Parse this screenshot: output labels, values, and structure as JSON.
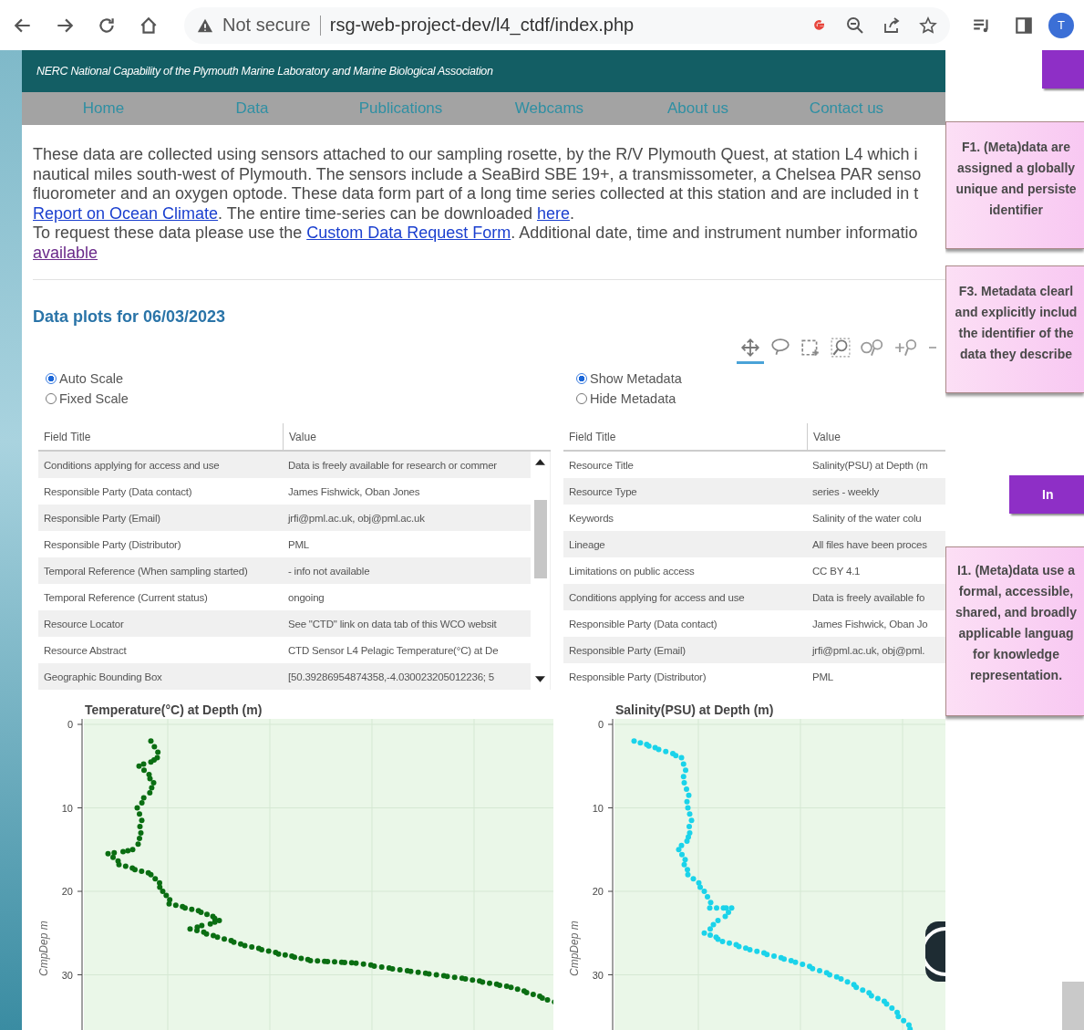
{
  "browser": {
    "security": "Not secure",
    "url": "rsg-web-project-dev/l4_ctdf/index.php",
    "profile_initial": "T"
  },
  "header": {
    "subtitle": "NERC National Capability of the Plymouth Marine Laboratory and Marine Biological Association"
  },
  "nav": [
    "Home",
    "Data",
    "Publications",
    "Webcams",
    "About us",
    "Contact us"
  ],
  "intro": [
    [
      {
        "text": "These data are collected using sensors attached to our sampling rosette, by the R/V Plymouth Quest, at station L4 which i",
        "link": false
      }
    ],
    [
      {
        "text": "nautical miles south-west of Plymouth. The sensors include a SeaBird SBE 19+, a transmissometer, a Chelsea PAR senso",
        "link": false
      }
    ],
    [
      {
        "text": "fluorometer and an oxygen optode. These data form part of a long time series collected at this station and are included in t",
        "link": false
      }
    ],
    [
      {
        "text": "Report on Ocean Climate",
        "link": true
      },
      {
        "text": ". The entire time-series can be downloaded ",
        "link": false
      },
      {
        "text": "here",
        "link": true
      },
      {
        "text": ".",
        "link": false
      }
    ],
    [
      {
        "text": "To request these data please use the ",
        "link": false
      },
      {
        "text": "Custom Data Request Form",
        "link": true
      },
      {
        "text": ". Additional date, time and instrument number informatio",
        "link": false
      }
    ],
    [
      {
        "text": "available",
        "link": true
      }
    ]
  ],
  "section_title": "Data plots for 06/03/2023",
  "plot_tools": [
    {
      "kind": "pan",
      "selected": true
    },
    {
      "kind": "lasso",
      "selected": false
    },
    {
      "kind": "box_select",
      "selected": false
    },
    {
      "kind": "box_zoom",
      "selected": false
    },
    {
      "kind": "reset",
      "selected": false
    },
    {
      "kind": "zoom_in",
      "selected": false
    },
    {
      "kind": "zoom_out",
      "selected": false
    }
  ],
  "panels": [
    {
      "options": [
        {
          "label": "Auto Scale",
          "selected": true
        },
        {
          "label": "Fixed Scale",
          "selected": false
        }
      ],
      "table": {
        "columns": [
          "Field Title",
          "Value"
        ],
        "scrollbar": true,
        "rows": [
          {
            "field": "Conditions applying for access and use",
            "value": "Data is freely available for research or commer",
            "shaded": true
          },
          {
            "field": "Responsible Party (Data contact)",
            "value": "James Fishwick, Oban Jones",
            "shaded": false
          },
          {
            "field": "Responsible Party (Email)",
            "value": "jrfi@pml.ac.uk, obj@pml.ac.uk",
            "shaded": true
          },
          {
            "field": "Responsible Party (Distributor)",
            "value": "PML",
            "shaded": false
          },
          {
            "field": "Temporal Reference (When sampling started)",
            "value": "- info not available",
            "shaded": true
          },
          {
            "field": "Temporal Reference (Current status)",
            "value": "ongoing",
            "shaded": false
          },
          {
            "field": "Resource Locator",
            "value": "See \"CTD\" link on data tab of this WCO websit",
            "shaded": true
          },
          {
            "field": "Resource Abstract",
            "value": "CTD Sensor L4 Pelagic Temperature(°C) at De",
            "shaded": false
          },
          {
            "field": "Geographic Bounding Box",
            "value": "[50.39286954874358,-4.030023205012236; 5",
            "shaded": true
          }
        ]
      },
      "chart": {
        "title": "Temperature(°C) at Depth (m)",
        "ylabel": "CmpDep m",
        "yticks": [
          "0",
          "10",
          "20",
          "30"
        ],
        "color": "#0a6e12"
      }
    },
    {
      "options": [
        {
          "label": "Show Metadata",
          "selected": true
        },
        {
          "label": "Hide Metadata",
          "selected": false
        }
      ],
      "table": {
        "columns": [
          "Field Title",
          "Value"
        ],
        "scrollbar": false,
        "rows": [
          {
            "field": "Resource Title",
            "value": "Salinity(PSU) at Depth (m",
            "shaded": false
          },
          {
            "field": "Resource Type",
            "value": "series - weekly",
            "shaded": true
          },
          {
            "field": "Keywords",
            "value": "Salinity of the water colu",
            "shaded": false
          },
          {
            "field": "Lineage",
            "value": "All files have been proces",
            "shaded": true
          },
          {
            "field": "Limitations on public access",
            "value": "CC BY 4.1",
            "shaded": false
          },
          {
            "field": "Conditions applying for access and use",
            "value": "Data is freely available fo",
            "shaded": true
          },
          {
            "field": "Responsible Party (Data contact)",
            "value": "James Fishwick, Oban Jo",
            "shaded": false
          },
          {
            "field": "Responsible Party (Email)",
            "value": "jrfi@pml.ac.uk, obj@pml.",
            "shaded": true
          },
          {
            "field": "Responsible Party (Distributor)",
            "value": "PML",
            "shaded": false
          }
        ]
      },
      "chart": {
        "title": "Salinity(PSU) at Depth (m)",
        "ylabel": "CmpDep m",
        "yticks": [
          "0",
          "10",
          "20",
          "30"
        ],
        "color": "#1ad3ea"
      }
    }
  ],
  "overlay": [
    {
      "kind": "button"
    },
    {
      "kind": "card",
      "lines": [
        "F1. (Meta)data are",
        "assigned a globally",
        "unique and persiste",
        "identifier"
      ]
    },
    {
      "kind": "card",
      "lines": [
        "F3. Metadata clearl",
        "and explicitly includ",
        "the identifier of the",
        "data they describe"
      ]
    },
    {
      "kind": "button",
      "text": "In"
    },
    {
      "kind": "card",
      "lines": [
        "I1. (Meta)data use a",
        "formal, accessible,",
        "shared, and broadly",
        "applicable languag",
        "for knowledge",
        "representation."
      ]
    }
  ]
}
